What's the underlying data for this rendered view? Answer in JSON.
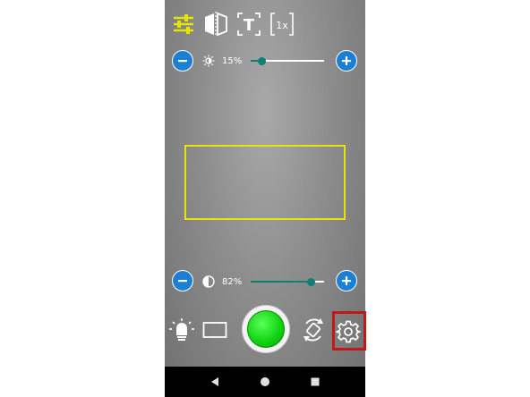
{
  "toolbar": {
    "icons": [
      "sliders-icon",
      "mirror-icon",
      "text-mode-icon",
      "zoom-1x-icon"
    ],
    "zoom_label": "1x",
    "text_label": "T"
  },
  "brightness": {
    "icon": "brightness-icon",
    "label": "15%",
    "value": 0.15,
    "minus": "−",
    "plus": "+"
  },
  "contrast": {
    "icon": "contrast-icon",
    "label": "82%",
    "value": 0.82,
    "minus": "−",
    "plus": "+"
  },
  "bottom_controls": {
    "icons": [
      "light-bulb-icon",
      "aspect-ratio-icon",
      "shutter-button",
      "rotate-icon",
      "settings-icon"
    ]
  },
  "nav": {
    "icons": [
      "back-icon",
      "home-icon",
      "recents-icon"
    ]
  },
  "colors": {
    "accent_yellow": "#e5e500",
    "button_blue": "#1b7fd6",
    "slider_teal": "#0d7f73",
    "shutter_green": "#13d613",
    "highlight_red": "#c0191b"
  }
}
